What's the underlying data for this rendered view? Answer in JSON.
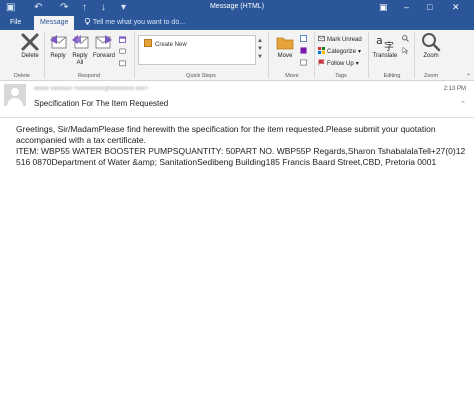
{
  "window": {
    "title": "Message (HTML)",
    "controls": [
      "–",
      "□",
      "✕"
    ]
  },
  "quick_access": {
    "save": "▣",
    "undo": "↶",
    "redo": "↷",
    "up": "↑",
    "down": "↓",
    "more": "▾"
  },
  "tabs": [
    {
      "label": "File"
    },
    {
      "label": "Message"
    }
  ],
  "tell_me": {
    "text": "Tell me what you want to do..."
  },
  "ribbon": {
    "delete": {
      "label": "Delete",
      "group": "Delete"
    },
    "respond": {
      "reply": "Reply",
      "reply_all": "Reply All",
      "forward": "Forward",
      "group": "Respond"
    },
    "quick_steps": {
      "create_new": "Create New",
      "group": "Quick Steps"
    },
    "move": {
      "label": "Move",
      "group": "Move"
    },
    "tags": {
      "mark_unread": "Mark Unread",
      "categorize": "Categorize",
      "follow_up": "Follow Up",
      "group": "Tags"
    },
    "editing": {
      "translate": "Translate",
      "group": "Editing"
    },
    "zoom": {
      "label": "Zoom",
      "group": "Zoom"
    }
  },
  "message": {
    "sender": "xxxxx xxxxxxx <xxxxxxxxx@xxxxxxxx.xxx>",
    "time": "2:13 PM",
    "subject": "Specification For The Item Requested",
    "body": [
      "Greetings, Sir/MadamPlease find herewith the specification for the item requested.Please submit your quotation accompanied with a tax certificate.",
      "ITEM: WBP55 WATER BOOSTER PUMPSQUANTITY: 50PART NO. WBP55P Regards,Sharon TshabalalaTell+27(0)12 516 0870Department of Water &amp; SanitationSedibeng Building185 Francis Baard Street,CBD, Pretoria 0001"
    ]
  },
  "colors": {
    "title_bar": "#2b579a",
    "ribbon": "#f3f3f3",
    "delete_icon": "#555555",
    "reply_icon": "#7e57c2",
    "move_icon": "#e8a23a"
  }
}
